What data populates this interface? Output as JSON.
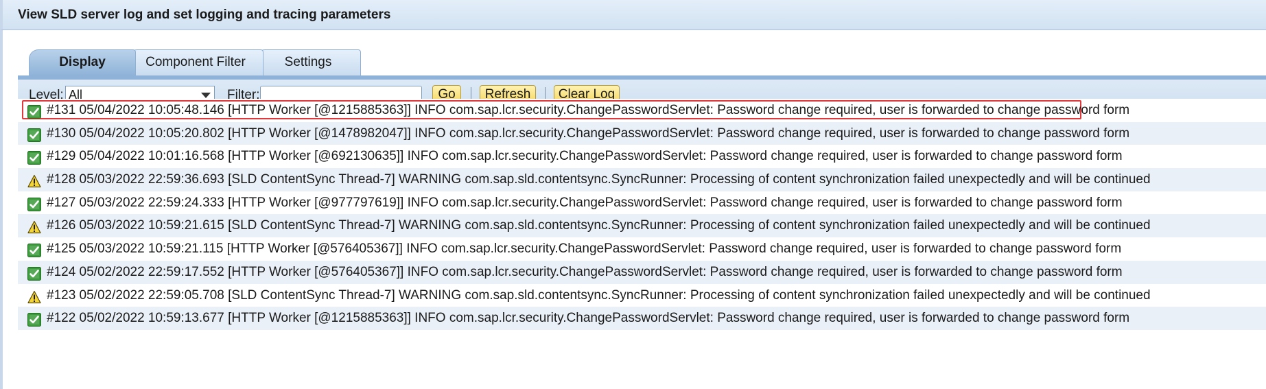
{
  "window": {
    "title": "View SLD server log and set logging and tracing parameters"
  },
  "tabs": [
    {
      "label": "Display",
      "active": true
    },
    {
      "label": "Component Filter",
      "active": false
    },
    {
      "label": "Settings",
      "active": false
    }
  ],
  "toolbar": {
    "level_label": "Level:",
    "level_value": "All",
    "filter_label": "Filter:",
    "filter_value": "",
    "go_label": "Go",
    "refresh_label": "Refresh",
    "clear_label": "Clear Log"
  },
  "log_entries": [
    {
      "level": "INFO",
      "icon": "check-icon",
      "text": "#131 05/04/2022 10:05:48.146 [HTTP Worker [@1215885363]] INFO com.sap.lcr.security.ChangePasswordServlet: Password change required, user is forwarded to change password form",
      "selected": true
    },
    {
      "level": "INFO",
      "icon": "check-icon",
      "text": "#130 05/04/2022 10:05:20.802 [HTTP Worker [@1478982047]] INFO com.sap.lcr.security.ChangePasswordServlet: Password change required, user is forwarded to change password form"
    },
    {
      "level": "INFO",
      "icon": "check-icon",
      "text": "#129 05/04/2022 10:01:16.568 [HTTP Worker [@692130635]] INFO com.sap.lcr.security.ChangePasswordServlet: Password change required, user is forwarded to change password form"
    },
    {
      "level": "WARNING",
      "icon": "warning-icon",
      "text": "#128 05/03/2022 22:59:36.693 [SLD ContentSync Thread-7] WARNING com.sap.sld.contentsync.SyncRunner: Processing of content synchronization failed unexpectedly and will be continued"
    },
    {
      "level": "INFO",
      "icon": "check-icon",
      "text": "#127 05/03/2022 22:59:24.333 [HTTP Worker [@977797619]] INFO com.sap.lcr.security.ChangePasswordServlet: Password change required, user is forwarded to change password form"
    },
    {
      "level": "WARNING",
      "icon": "warning-icon",
      "text": "#126 05/03/2022 10:59:21.615 [SLD ContentSync Thread-7] WARNING com.sap.sld.contentsync.SyncRunner: Processing of content synchronization failed unexpectedly and will be continued"
    },
    {
      "level": "INFO",
      "icon": "check-icon",
      "text": "#125 05/03/2022 10:59:21.115 [HTTP Worker [@576405367]] INFO com.sap.lcr.security.ChangePasswordServlet: Password change required, user is forwarded to change password form"
    },
    {
      "level": "INFO",
      "icon": "check-icon",
      "text": "#124 05/02/2022 22:59:17.552 [HTTP Worker [@576405367]] INFO com.sap.lcr.security.ChangePasswordServlet: Password change required, user is forwarded to change password form"
    },
    {
      "level": "WARNING",
      "icon": "warning-icon",
      "text": "#123 05/02/2022 22:59:05.708 [SLD ContentSync Thread-7] WARNING com.sap.sld.contentsync.SyncRunner: Processing of content synchronization failed unexpectedly and will be continued"
    },
    {
      "level": "INFO",
      "icon": "check-icon",
      "text": "#122 05/02/2022 10:59:13.677 [HTTP Worker [@1215885363]] INFO com.sap.lcr.security.ChangePasswordServlet: Password change required, user is forwarded to change password form"
    }
  ],
  "colors": {
    "info_icon_bg": "#3a9b3a",
    "warning_icon_fill": "#f5d533",
    "selection_outline": "#e0383b",
    "button_gradient_top": "#fff3b3",
    "button_gradient_bottom": "#f5d55a"
  }
}
